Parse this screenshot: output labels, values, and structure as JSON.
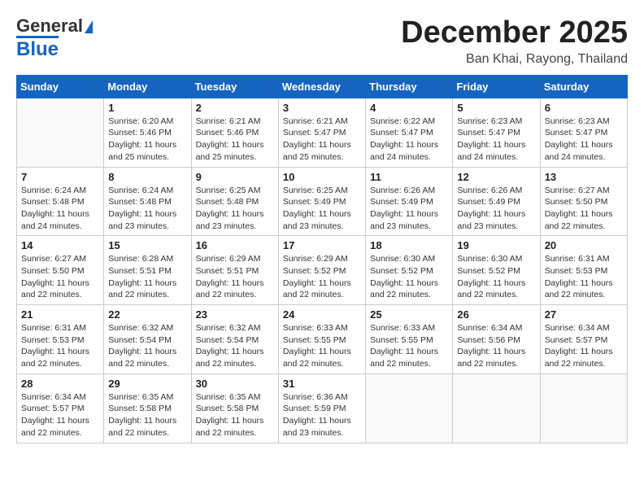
{
  "header": {
    "logo_line1": "General",
    "logo_line2": "Blue",
    "month": "December 2025",
    "location": "Ban Khai, Rayong, Thailand"
  },
  "weekdays": [
    "Sunday",
    "Monday",
    "Tuesday",
    "Wednesday",
    "Thursday",
    "Friday",
    "Saturday"
  ],
  "weeks": [
    [
      {
        "day": "",
        "sunrise": "",
        "sunset": "",
        "daylight": ""
      },
      {
        "day": "1",
        "sunrise": "Sunrise: 6:20 AM",
        "sunset": "Sunset: 5:46 PM",
        "daylight": "Daylight: 11 hours and 25 minutes."
      },
      {
        "day": "2",
        "sunrise": "Sunrise: 6:21 AM",
        "sunset": "Sunset: 5:46 PM",
        "daylight": "Daylight: 11 hours and 25 minutes."
      },
      {
        "day": "3",
        "sunrise": "Sunrise: 6:21 AM",
        "sunset": "Sunset: 5:47 PM",
        "daylight": "Daylight: 11 hours and 25 minutes."
      },
      {
        "day": "4",
        "sunrise": "Sunrise: 6:22 AM",
        "sunset": "Sunset: 5:47 PM",
        "daylight": "Daylight: 11 hours and 24 minutes."
      },
      {
        "day": "5",
        "sunrise": "Sunrise: 6:23 AM",
        "sunset": "Sunset: 5:47 PM",
        "daylight": "Daylight: 11 hours and 24 minutes."
      },
      {
        "day": "6",
        "sunrise": "Sunrise: 6:23 AM",
        "sunset": "Sunset: 5:47 PM",
        "daylight": "Daylight: 11 hours and 24 minutes."
      }
    ],
    [
      {
        "day": "7",
        "sunrise": "Sunrise: 6:24 AM",
        "sunset": "Sunset: 5:48 PM",
        "daylight": "Daylight: 11 hours and 24 minutes."
      },
      {
        "day": "8",
        "sunrise": "Sunrise: 6:24 AM",
        "sunset": "Sunset: 5:48 PM",
        "daylight": "Daylight: 11 hours and 23 minutes."
      },
      {
        "day": "9",
        "sunrise": "Sunrise: 6:25 AM",
        "sunset": "Sunset: 5:48 PM",
        "daylight": "Daylight: 11 hours and 23 minutes."
      },
      {
        "day": "10",
        "sunrise": "Sunrise: 6:25 AM",
        "sunset": "Sunset: 5:49 PM",
        "daylight": "Daylight: 11 hours and 23 minutes."
      },
      {
        "day": "11",
        "sunrise": "Sunrise: 6:26 AM",
        "sunset": "Sunset: 5:49 PM",
        "daylight": "Daylight: 11 hours and 23 minutes."
      },
      {
        "day": "12",
        "sunrise": "Sunrise: 6:26 AM",
        "sunset": "Sunset: 5:49 PM",
        "daylight": "Daylight: 11 hours and 23 minutes."
      },
      {
        "day": "13",
        "sunrise": "Sunrise: 6:27 AM",
        "sunset": "Sunset: 5:50 PM",
        "daylight": "Daylight: 11 hours and 22 minutes."
      }
    ],
    [
      {
        "day": "14",
        "sunrise": "Sunrise: 6:27 AM",
        "sunset": "Sunset: 5:50 PM",
        "daylight": "Daylight: 11 hours and 22 minutes."
      },
      {
        "day": "15",
        "sunrise": "Sunrise: 6:28 AM",
        "sunset": "Sunset: 5:51 PM",
        "daylight": "Daylight: 11 hours and 22 minutes."
      },
      {
        "day": "16",
        "sunrise": "Sunrise: 6:29 AM",
        "sunset": "Sunset: 5:51 PM",
        "daylight": "Daylight: 11 hours and 22 minutes."
      },
      {
        "day": "17",
        "sunrise": "Sunrise: 6:29 AM",
        "sunset": "Sunset: 5:52 PM",
        "daylight": "Daylight: 11 hours and 22 minutes."
      },
      {
        "day": "18",
        "sunrise": "Sunrise: 6:30 AM",
        "sunset": "Sunset: 5:52 PM",
        "daylight": "Daylight: 11 hours and 22 minutes."
      },
      {
        "day": "19",
        "sunrise": "Sunrise: 6:30 AM",
        "sunset": "Sunset: 5:52 PM",
        "daylight": "Daylight: 11 hours and 22 minutes."
      },
      {
        "day": "20",
        "sunrise": "Sunrise: 6:31 AM",
        "sunset": "Sunset: 5:53 PM",
        "daylight": "Daylight: 11 hours and 22 minutes."
      }
    ],
    [
      {
        "day": "21",
        "sunrise": "Sunrise: 6:31 AM",
        "sunset": "Sunset: 5:53 PM",
        "daylight": "Daylight: 11 hours and 22 minutes."
      },
      {
        "day": "22",
        "sunrise": "Sunrise: 6:32 AM",
        "sunset": "Sunset: 5:54 PM",
        "daylight": "Daylight: 11 hours and 22 minutes."
      },
      {
        "day": "23",
        "sunrise": "Sunrise: 6:32 AM",
        "sunset": "Sunset: 5:54 PM",
        "daylight": "Daylight: 11 hours and 22 minutes."
      },
      {
        "day": "24",
        "sunrise": "Sunrise: 6:33 AM",
        "sunset": "Sunset: 5:55 PM",
        "daylight": "Daylight: 11 hours and 22 minutes."
      },
      {
        "day": "25",
        "sunrise": "Sunrise: 6:33 AM",
        "sunset": "Sunset: 5:55 PM",
        "daylight": "Daylight: 11 hours and 22 minutes."
      },
      {
        "day": "26",
        "sunrise": "Sunrise: 6:34 AM",
        "sunset": "Sunset: 5:56 PM",
        "daylight": "Daylight: 11 hours and 22 minutes."
      },
      {
        "day": "27",
        "sunrise": "Sunrise: 6:34 AM",
        "sunset": "Sunset: 5:57 PM",
        "daylight": "Daylight: 11 hours and 22 minutes."
      }
    ],
    [
      {
        "day": "28",
        "sunrise": "Sunrise: 6:34 AM",
        "sunset": "Sunset: 5:57 PM",
        "daylight": "Daylight: 11 hours and 22 minutes."
      },
      {
        "day": "29",
        "sunrise": "Sunrise: 6:35 AM",
        "sunset": "Sunset: 5:58 PM",
        "daylight": "Daylight: 11 hours and 22 minutes."
      },
      {
        "day": "30",
        "sunrise": "Sunrise: 6:35 AM",
        "sunset": "Sunset: 5:58 PM",
        "daylight": "Daylight: 11 hours and 22 minutes."
      },
      {
        "day": "31",
        "sunrise": "Sunrise: 6:36 AM",
        "sunset": "Sunset: 5:59 PM",
        "daylight": "Daylight: 11 hours and 23 minutes."
      },
      {
        "day": "",
        "sunrise": "",
        "sunset": "",
        "daylight": ""
      },
      {
        "day": "",
        "sunrise": "",
        "sunset": "",
        "daylight": ""
      },
      {
        "day": "",
        "sunrise": "",
        "sunset": "",
        "daylight": ""
      }
    ]
  ]
}
